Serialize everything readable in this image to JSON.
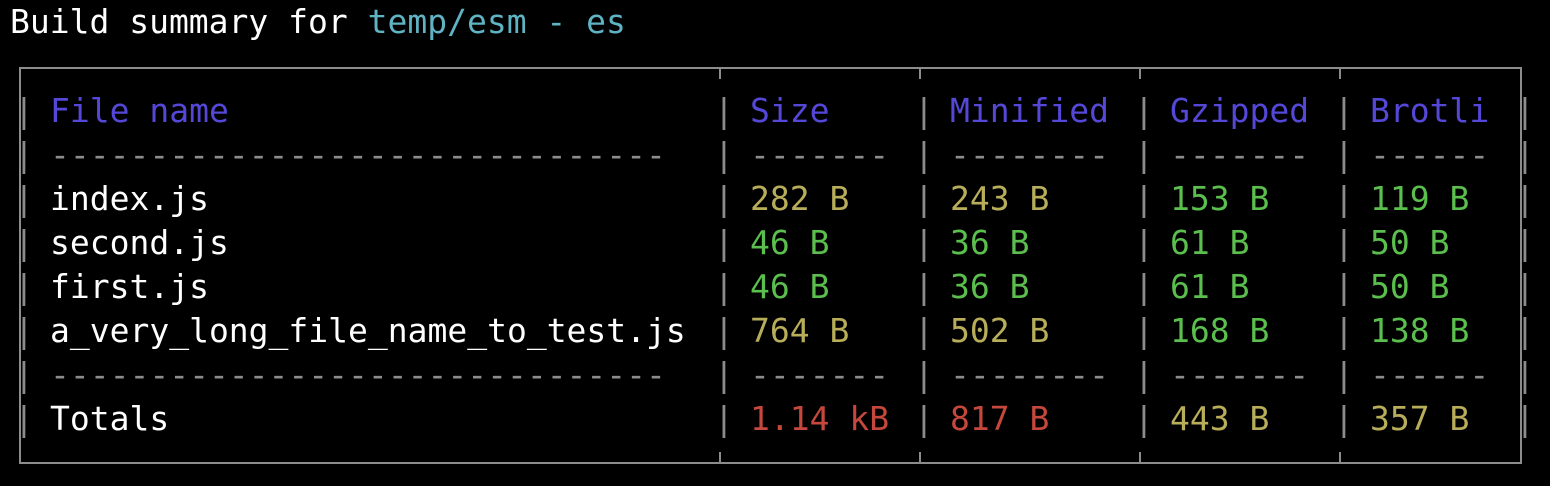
{
  "title": {
    "prefix": "Build summary for ",
    "target": "temp/esm - es"
  },
  "colors": {
    "header": "#5548d8",
    "target": "#5fb3c3",
    "yellow": "#b8ae5a",
    "green": "#5bbf4d",
    "red": "#c6483c",
    "border": "#8c8c8c"
  },
  "table": {
    "headers": [
      "File name",
      "Size",
      "Minified",
      "Gzipped",
      "Brotli"
    ],
    "dividers": [
      "-------------------------------",
      "-------",
      "--------",
      "-------",
      "------"
    ],
    "rows": [
      {
        "file": "index.js",
        "size": "282 B",
        "minified": "243 B",
        "gzipped": "153 B",
        "brotli": "119 B",
        "colors": [
          "yellow",
          "yellow",
          "green",
          "green"
        ]
      },
      {
        "file": "second.js",
        "size": "46 B",
        "minified": "36 B",
        "gzipped": "61 B",
        "brotli": "50 B",
        "colors": [
          "green",
          "green",
          "green",
          "green"
        ]
      },
      {
        "file": "first.js",
        "size": "46 B",
        "minified": "36 B",
        "gzipped": "61 B",
        "brotli": "50 B",
        "colors": [
          "green",
          "green",
          "green",
          "green"
        ]
      },
      {
        "file": "a_very_long_file_name_to_test.js",
        "size": "764 B",
        "minified": "502 B",
        "gzipped": "168 B",
        "brotli": "138 B",
        "colors": [
          "yellow",
          "yellow",
          "green",
          "green"
        ]
      }
    ],
    "totals": {
      "label": "Totals",
      "size": "1.14 kB",
      "minified": "817 B",
      "gzipped": "443 B",
      "brotli": "357 B",
      "colors": [
        "red",
        "red",
        "yellow",
        "yellow"
      ]
    }
  }
}
